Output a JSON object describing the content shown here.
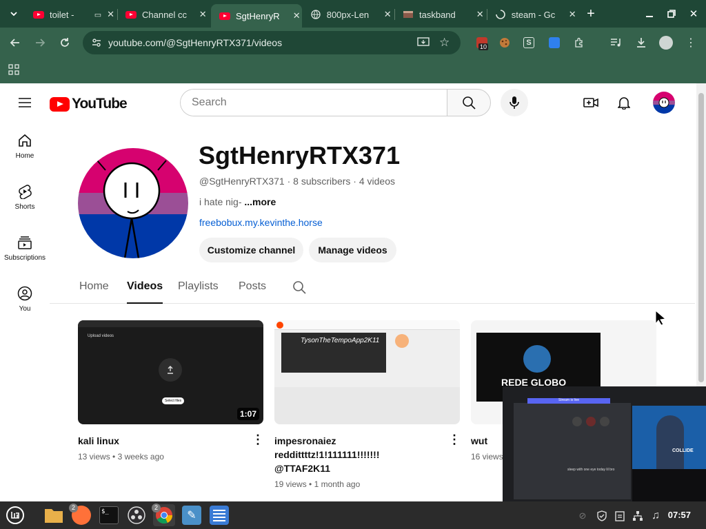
{
  "browser": {
    "tabs": [
      {
        "title": "toilet -",
        "favicon": "youtube-icon"
      },
      {
        "title": "Channel cc",
        "favicon": "youtube-icon"
      },
      {
        "title": "SgtHenryR",
        "favicon": "youtube-icon",
        "active": true
      },
      {
        "title": "800px-Len",
        "favicon": "globe-icon"
      },
      {
        "title": "taskband",
        "favicon": "image-icon"
      },
      {
        "title": "steam - Gc",
        "favicon": "loading-icon"
      }
    ],
    "new_tab_label": "+",
    "url": "youtube.com/@SgtHenryRTX371/videos",
    "extension_badge": "10"
  },
  "youtube": {
    "logo_text": "YouTube",
    "search_placeholder": "Search",
    "guide": [
      {
        "label": "Home",
        "icon": "home-icon"
      },
      {
        "label": "Shorts",
        "icon": "shorts-icon"
      },
      {
        "label": "Subscriptions",
        "icon": "subscriptions-icon"
      },
      {
        "label": "You",
        "icon": "you-icon"
      }
    ],
    "channel": {
      "name": "SgtHenryRTX371",
      "handle": "@SgtHenryRTX371",
      "subscribers": "8 subscribers",
      "videos_count": "4 videos",
      "meta_sep": " · ",
      "description": "i hate nig-",
      "more_label": "...more",
      "link": "freebobux.my.kevinthe.horse",
      "customize_label": "Customize channel",
      "manage_label": "Manage videos"
    },
    "tabs": [
      "Home",
      "Videos",
      "Playlists",
      "Posts"
    ],
    "selected_tab": "Videos",
    "videos": [
      {
        "title": "kali linux",
        "views": "13 views",
        "age": "3 weeks ago",
        "duration": "1:07",
        "thumb_caption": "Upload videos",
        "thumb_button": "Select files"
      },
      {
        "title": "impesronaiez reddittttz!1!111111!!!!!!! @TTAF2K11",
        "views": "19 views",
        "age": "1 month ago",
        "duration": "",
        "thumb_caption": "TysonTheTempoApp2K11"
      },
      {
        "title": "wut",
        "views": "16 views",
        "age": "",
        "duration": "",
        "thumb_caption": "REDE GLOBO"
      }
    ]
  },
  "taskbar": {
    "apps": [
      "mint-menu-icon",
      "files-icon",
      "firefox-icon",
      "terminal-icon",
      "obs-icon",
      "chrome-icon",
      "editor-icon",
      "notes-icon"
    ],
    "firefox_badge": "2",
    "chrome_badge": "2",
    "clock": "07:57"
  },
  "overlay": {
    "discord_status": "Stream is live",
    "chat_line": "sleep with one eye today lil bro",
    "shirt_text": "COLLIDE"
  },
  "colors": {
    "brand_red": "#ff0000",
    "chrome_dark": "#1f4736",
    "chrome_mid": "#35624c",
    "link_blue": "#065fd4"
  }
}
